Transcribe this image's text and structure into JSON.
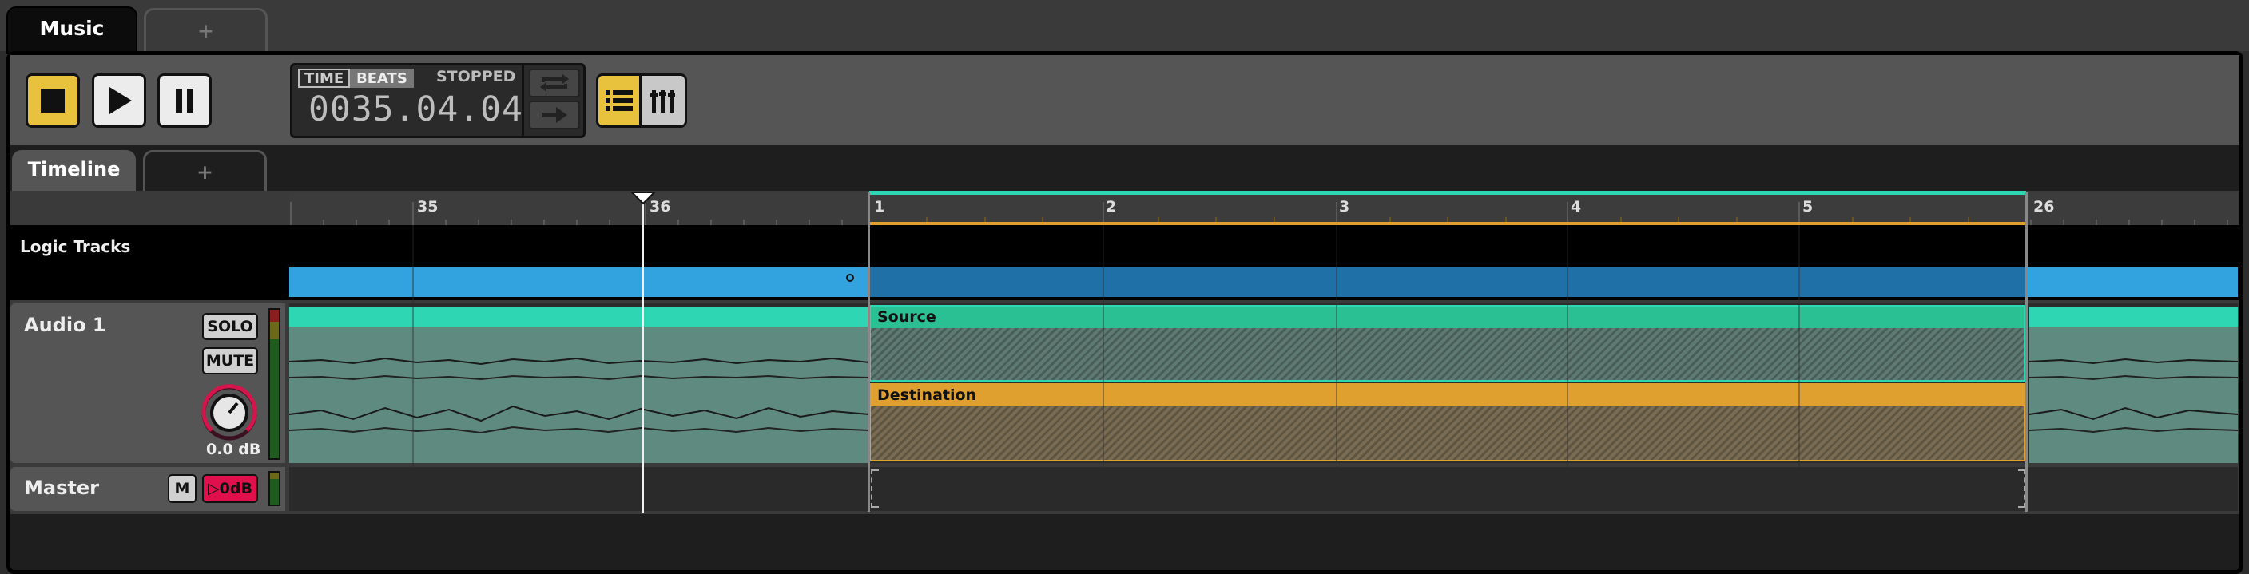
{
  "window_tabs": {
    "active": "Music",
    "add": "+"
  },
  "transport": {
    "stop_icon": "stop-icon",
    "play_icon": "play-icon",
    "pause_icon": "pause-icon",
    "time_mode": "TIME",
    "beats_mode": "BEATS",
    "status": "STOPPED",
    "position": "0035.04.04",
    "loop_icon": "loop-icon",
    "follow_icon": "arrow-right-icon",
    "list_view_icon": "list-view-icon",
    "mixer_view_icon": "mixer-view-icon"
  },
  "timeline_tabs": {
    "active": "Timeline",
    "add": "+"
  },
  "ruler": {
    "labels": [
      "35",
      "36",
      "1",
      "2",
      "3",
      "4",
      "5",
      "26"
    ]
  },
  "logic_tracks": {
    "label": "Logic Tracks"
  },
  "tracks": [
    {
      "name": "Audio 1",
      "solo": "SOLO",
      "mute": "MUTE",
      "volume": "0.0 dB",
      "clips": [
        {
          "name": "Source",
          "color": "#2bbf94"
        },
        {
          "name": "Destination",
          "color": "#e0a030"
        }
      ]
    },
    {
      "name": "Master",
      "mute": "M",
      "meter_label": "▷0dB"
    }
  ],
  "colors": {
    "accent": "#e8c23c",
    "loop_region": "#2fd6b4",
    "logic_bar": "#33a3e0",
    "source": "#2bbf94",
    "destination": "#e0a030"
  }
}
